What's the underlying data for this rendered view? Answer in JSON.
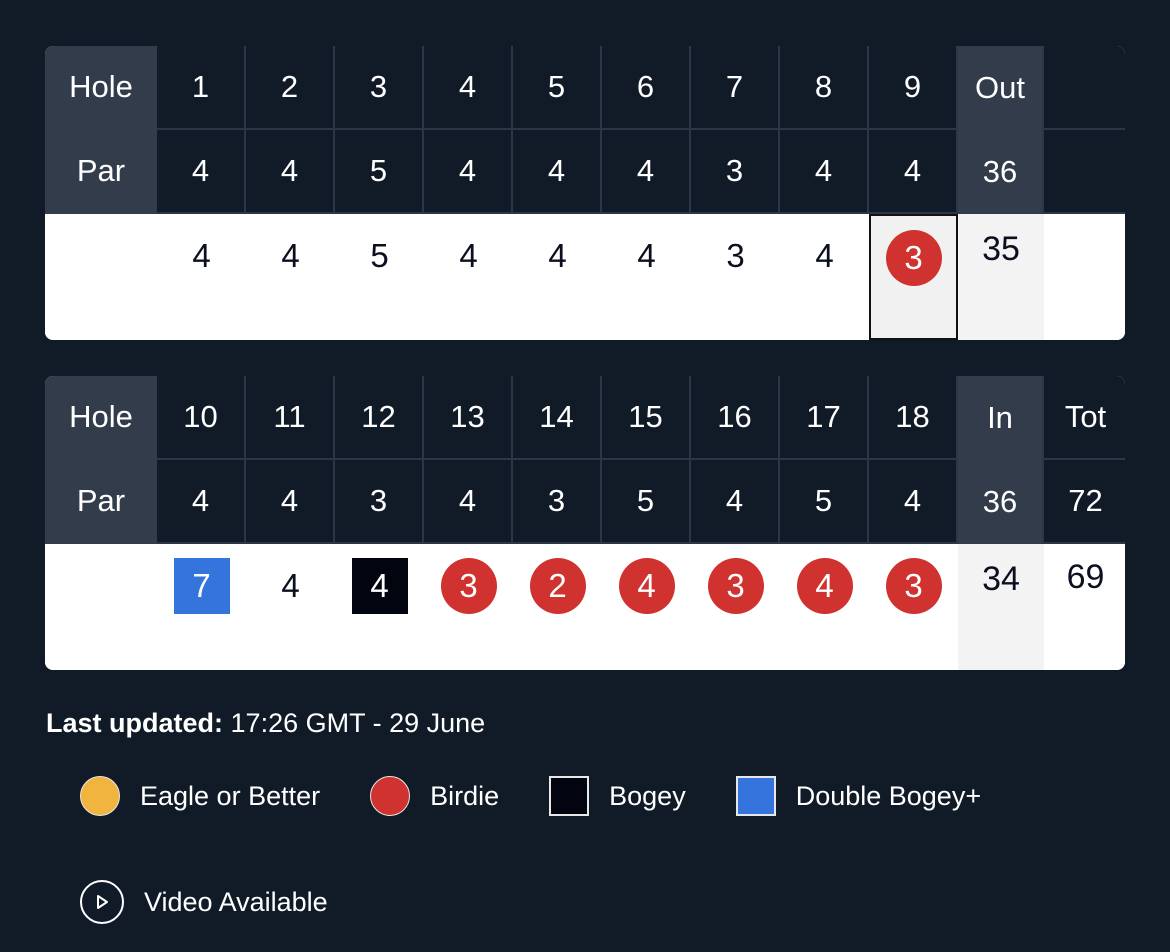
{
  "front_nine": {
    "hole_label": "Hole",
    "par_label": "Par",
    "holes": [
      "1",
      "2",
      "3",
      "4",
      "5",
      "6",
      "7",
      "8",
      "9"
    ],
    "pars": [
      "4",
      "4",
      "5",
      "4",
      "4",
      "4",
      "3",
      "4",
      "4"
    ],
    "subtotal_label": "Out",
    "subtotal_par": "36",
    "total_label": "",
    "total_par": "",
    "scores": [
      {
        "value": "4",
        "type": "par"
      },
      {
        "value": "4",
        "type": "par"
      },
      {
        "value": "5",
        "type": "par"
      },
      {
        "value": "4",
        "type": "par"
      },
      {
        "value": "4",
        "type": "par"
      },
      {
        "value": "4",
        "type": "par"
      },
      {
        "value": "3",
        "type": "par"
      },
      {
        "value": "4",
        "type": "par"
      },
      {
        "value": "3",
        "type": "birdie",
        "selected": true
      }
    ],
    "subtotal_score": "35",
    "total_score": ""
  },
  "back_nine": {
    "hole_label": "Hole",
    "par_label": "Par",
    "holes": [
      "10",
      "11",
      "12",
      "13",
      "14",
      "15",
      "16",
      "17",
      "18"
    ],
    "pars": [
      "4",
      "4",
      "3",
      "4",
      "3",
      "5",
      "4",
      "5",
      "4"
    ],
    "subtotal_label": "In",
    "subtotal_par": "36",
    "total_label": "Tot",
    "total_par": "72",
    "scores": [
      {
        "value": "7",
        "type": "double"
      },
      {
        "value": "4",
        "type": "par"
      },
      {
        "value": "4",
        "type": "bogey"
      },
      {
        "value": "3",
        "type": "birdie"
      },
      {
        "value": "2",
        "type": "birdie"
      },
      {
        "value": "4",
        "type": "birdie"
      },
      {
        "value": "3",
        "type": "birdie"
      },
      {
        "value": "4",
        "type": "birdie"
      },
      {
        "value": "3",
        "type": "birdie"
      }
    ],
    "subtotal_score": "34",
    "total_score": "69"
  },
  "last_updated": {
    "label": "Last updated:",
    "value": "17:26 GMT - 29 June"
  },
  "legend": [
    {
      "label": "Eagle or Better",
      "icon": "eagle-circle-icon",
      "color": "#f1b43f"
    },
    {
      "label": "Birdie",
      "icon": "birdie-circle-icon",
      "color": "#d0322f"
    },
    {
      "label": "Bogey",
      "icon": "bogey-square-icon",
      "color": "#02040f"
    },
    {
      "label": "Double Bogey+",
      "icon": "double-bogey-square-icon",
      "color": "#3574dc"
    },
    {
      "label": "Video Available",
      "icon": "play-circle-icon"
    }
  ],
  "colors": {
    "background": "#111b27",
    "header_cell": "#111b27",
    "label_cell": "#333c4b",
    "birdie": "#d0322f",
    "eagle": "#f1b43f",
    "bogey": "#02040f",
    "double_bogey": "#3574dc"
  }
}
